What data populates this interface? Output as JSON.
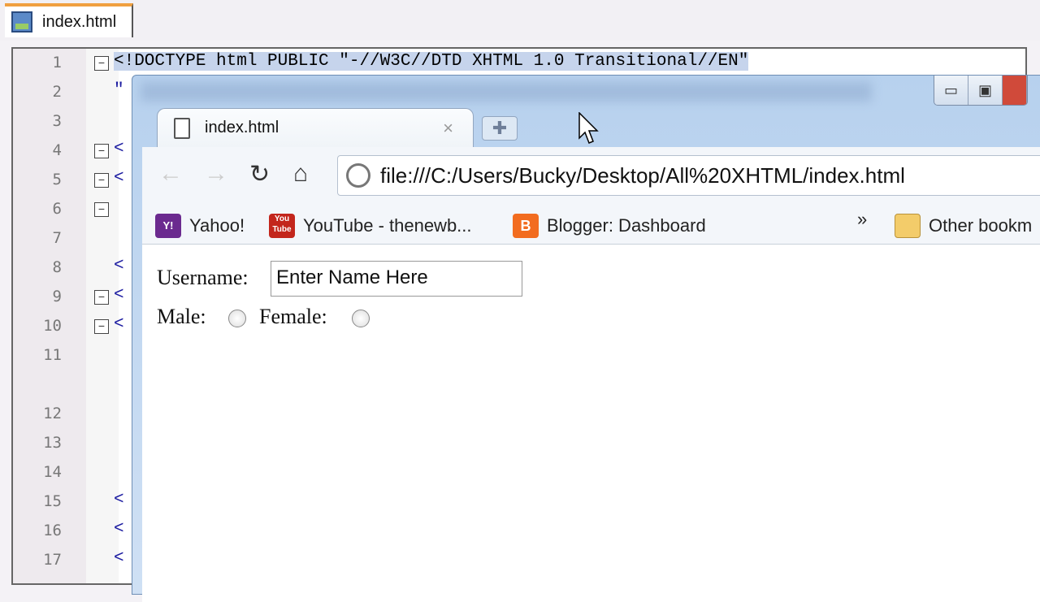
{
  "editor": {
    "tab_label": "index.html",
    "lines": [
      {
        "n": "1",
        "code": "<!DOCTYPE html PUBLIC \"-//W3C//DTD XHTML 1.0 Transitional//EN\""
      },
      {
        "n": "2",
        "code": "\""
      },
      {
        "n": "3",
        "code": ""
      },
      {
        "n": "4",
        "code": "<"
      },
      {
        "n": "5",
        "code": "<"
      },
      {
        "n": "6",
        "code": ""
      },
      {
        "n": "7",
        "code": ""
      },
      {
        "n": "8",
        "code": "<"
      },
      {
        "n": "9",
        "code": "<"
      },
      {
        "n": "10",
        "code": "<"
      },
      {
        "n": "11",
        "code": ""
      },
      {
        "n": "12",
        "code": ""
      },
      {
        "n": "13",
        "code": ""
      },
      {
        "n": "14",
        "code": ""
      },
      {
        "n": "15",
        "code": "<"
      },
      {
        "n": "16",
        "code": "<"
      },
      {
        "n": "17",
        "code": "<"
      }
    ]
  },
  "browser": {
    "tab_title": "index.html",
    "url": "file:///C:/Users/Bucky/Desktop/All%20XHTML/index.html",
    "bookmarks": [
      "Yahoo!",
      "YouTube - thenewb...",
      "Blogger: Dashboard"
    ],
    "bookmark_icons": {
      "yahoo": "Y!",
      "youtube": "You Tube",
      "blogger": "B"
    },
    "overflow": "»",
    "other_bookmarks": "Other bookm",
    "page": {
      "username_label": "Username:",
      "username_value": "Enter Name Here",
      "male_label": "Male:",
      "female_label": "Female:"
    }
  }
}
